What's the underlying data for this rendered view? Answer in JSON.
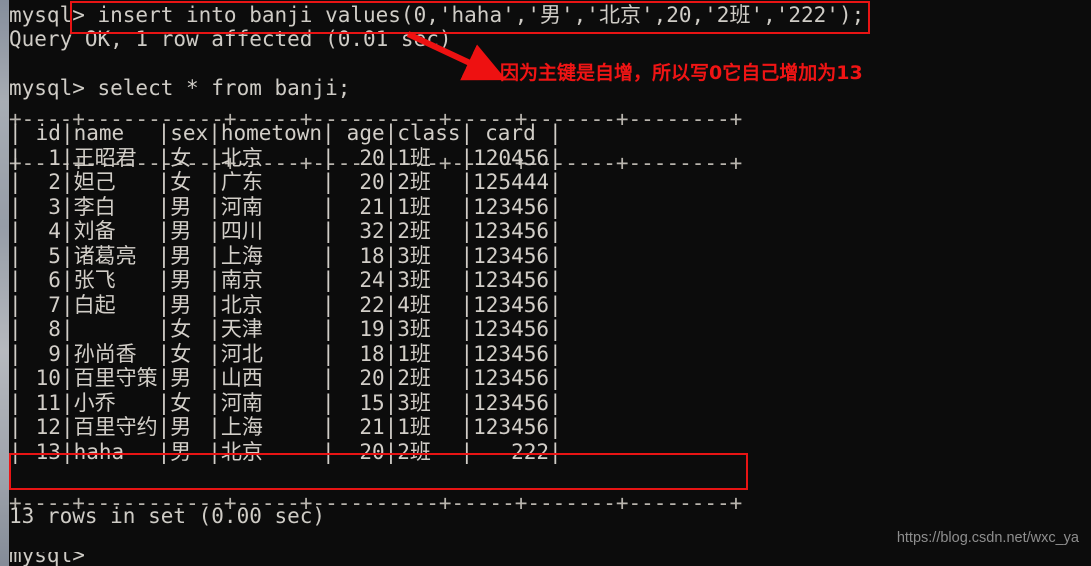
{
  "terminal": {
    "prompt": "mysql>",
    "lines": [
      {
        "name": "insert-command-line",
        "prompt": "mysql>",
        "text": " insert into banji values(0,'haha','男','北京',20,'2班','222');"
      },
      {
        "name": "query-ok-line",
        "prompt": "",
        "text": "Query OK, 1 row affected (0.01 sec)"
      },
      {
        "name": "select-command-line",
        "prompt": "mysql>",
        "text": " select * from banji;"
      }
    ],
    "result_footer": "13 rows in set (0.00 sec)",
    "trailing_prompt": "mysql>"
  },
  "table": {
    "border_row": "+----+-----------+-----+----------+-----+-------+--------+",
    "columns": [
      "id",
      "name",
      "sex",
      "hometown",
      "age",
      "class",
      "card"
    ],
    "rows": [
      {
        "id": "1",
        "name": "王昭君",
        "sex": "女",
        "hometown": "北京",
        "age": "20",
        "class": "1班",
        "card": "120456"
      },
      {
        "id": "2",
        "name": "妲己",
        "sex": "女",
        "hometown": "广东",
        "age": "20",
        "class": "2班",
        "card": "125444"
      },
      {
        "id": "3",
        "name": "李白",
        "sex": "男",
        "hometown": "河南",
        "age": "21",
        "class": "1班",
        "card": "123456"
      },
      {
        "id": "4",
        "name": "刘备",
        "sex": "男",
        "hometown": "四川",
        "age": "32",
        "class": "2班",
        "card": "123456"
      },
      {
        "id": "5",
        "name": "诸葛亮",
        "sex": "男",
        "hometown": "上海",
        "age": "18",
        "class": "3班",
        "card": "123456"
      },
      {
        "id": "6",
        "name": "张飞",
        "sex": "男",
        "hometown": "南京",
        "age": "24",
        "class": "3班",
        "card": "123456"
      },
      {
        "id": "7",
        "name": "白起",
        "sex": "男",
        "hometown": "北京",
        "age": "22",
        "class": "4班",
        "card": "123456"
      },
      {
        "id": "8",
        "name": "",
        "sex": "女",
        "hometown": "天津",
        "age": "19",
        "class": "3班",
        "card": "123456"
      },
      {
        "id": "9",
        "name": "孙尚香",
        "sex": "女",
        "hometown": "河北",
        "age": "18",
        "class": "1班",
        "card": "123456"
      },
      {
        "id": "10",
        "name": "百里守策",
        "sex": "男",
        "hometown": "山西",
        "age": "20",
        "class": "2班",
        "card": "123456"
      },
      {
        "id": "11",
        "name": "小乔",
        "sex": "女",
        "hometown": "河南",
        "age": "15",
        "class": "3班",
        "card": "123456"
      },
      {
        "id": "12",
        "name": "百里守约",
        "sex": "男",
        "hometown": "上海",
        "age": "21",
        "class": "1班",
        "card": "123456"
      },
      {
        "id": "13",
        "name": "haha",
        "sex": "男",
        "hometown": "北京",
        "age": "20",
        "class": "2班",
        "card": "222"
      }
    ]
  },
  "annotation": {
    "text": "因为主键是自增，所以写0它自己增加为13",
    "color": "#f01414"
  },
  "highlights": {
    "insert_box_label": "insert-statement-highlight",
    "new_row_box_label": "new-row-highlight",
    "box_color": "#e81414"
  },
  "watermark": {
    "text": "https://blog.csdn.net/wxc_ya"
  },
  "theme": {
    "background": "#0c0c0c",
    "foreground": "#cfccc6"
  }
}
